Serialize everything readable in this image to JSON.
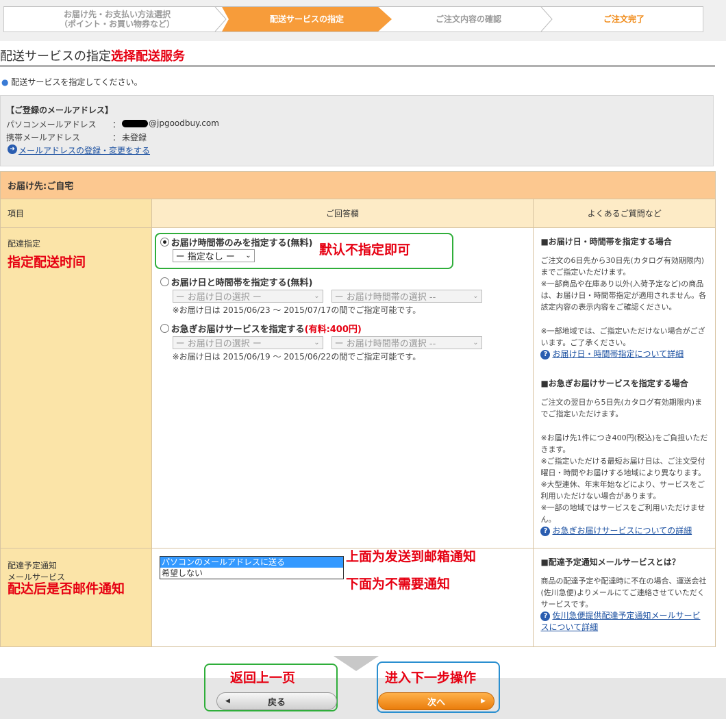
{
  "steps": [
    {
      "label_1": "お届け先・お支払い方法選択",
      "label_2": "（ポイント・お買い物券など）"
    },
    {
      "label_1": "配送サービスの指定"
    },
    {
      "label_1": "ご注文内容の確認"
    },
    {
      "label_1": "ご注文完了"
    }
  ],
  "title": {
    "text": "配送サービスの指定",
    "annotation": "选择配送服务"
  },
  "intro": "配送サービスを指定してください。",
  "mail": {
    "heading": "【ご登録のメールアドレス】",
    "pc_label": "パソコンメールアドレス",
    "pc_value": "@jpgoodbuy.com",
    "mobile_label": "携帯メールアドレス",
    "mobile_value": "未登録",
    "colon": "：",
    "change_link": "メールアドレスの登録・変更をする"
  },
  "table": {
    "destination": "お届け先:ご自宅",
    "col_item": "項目",
    "col_answer": "ご回答欄",
    "col_faq": "よくあるご質問など"
  },
  "delivery": {
    "label": "配達指定",
    "annotation": "指定配送时间",
    "opt1": "お届け時間帯のみを指定する(無料)",
    "opt1_select": "ー 指定なし ー",
    "opt1_annotation": "默认不指定即可",
    "opt2": "お届け日と時間帯を指定する(無料)",
    "opt2_date_select": "ー お届け日の選択 ー",
    "opt2_time_select": "ー お届け時間帯の選択 --",
    "opt2_note": "※お届け日は 2015/06/23 〜 2015/07/17の間でご指定可能です。",
    "opt3": "お急ぎお届けサービスを指定する",
    "opt3_fee": "(有料:400円)",
    "opt3_date_select": "ー お届け日の選択 ー",
    "opt3_time_select": "ー お届け時間帯の選択 --",
    "opt3_note": "※お届け日は 2015/06/19 〜 2015/06/22の間でご指定可能です。"
  },
  "faq1": {
    "heading": "■お届け日・時間帯を指定する場合",
    "p1": "ご注文の6日先から30日先(カタログ有効期限内)までご指定いただけます。",
    "p2": "※一部商品や在庫あり以外(入荷予定など)の商品は、お届け日・時間帯指定が適用されません。各該定内容の表示内容をご確認ください。",
    "p3": "※一部地域では、ご指定いただけない場合がございます。ご了承ください。",
    "link": "お届け日・時間帯指定について詳細"
  },
  "faq2": {
    "heading": "■お急ぎお届けサービスを指定する場合",
    "p1": "ご注文の翌日から5日先(カタログ有効期限内)までご指定いただけます。",
    "p2": "※お届け先1件につき400円(税込)をご負担いただきます。",
    "p3": "※ご指定いただける最短お届け日は、ご注文受付曜日・時間やお届けする地域により異なります。",
    "p4": "※大型連休、年末年始などにより、サービスをご利用いただけない場合があります。",
    "p5": "※一部の地域ではサービスをご利用いただけません。",
    "link": "お急ぎお届けサービスについての詳細"
  },
  "notify": {
    "label": "配達予定通知",
    "sublabel": "メールサービス",
    "annotation": "配达后是否邮件通知",
    "opt_send": "パソコンのメールアドレスに送る",
    "opt_none": "希望しない",
    "ann_top": "上面为发送到邮箱通知",
    "ann_bottom": "下面为不需要通知"
  },
  "faq3": {
    "heading": "■配達予定通知メールサービスとは？",
    "p1": "商品の配達予定や配達時に不在の場合、運送会社(佐川急便)よりメールにてご連絡させていただくサービスです。",
    "link": "佐川急便提供配達予定通知メールサービスについて詳細"
  },
  "footer": {
    "back_annotation": "返回上一页",
    "back_label": "戻る",
    "next_annotation": "进入下一步操作",
    "next_label": "次へ"
  },
  "colors": {
    "accent": "#f79c3a",
    "annotation": "#e60012",
    "highlight_green": "#2fae3a",
    "highlight_blue": "#2a8fd0"
  }
}
